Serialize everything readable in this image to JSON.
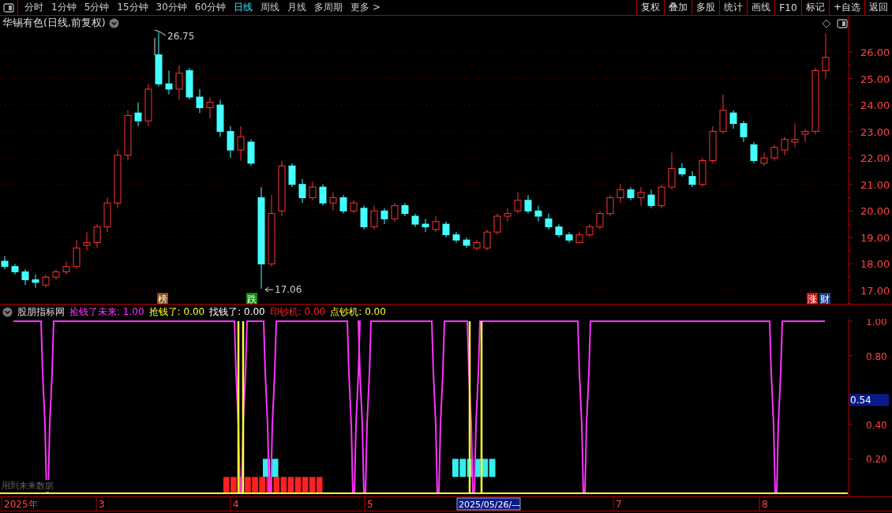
{
  "toolbar": {
    "periods": [
      {
        "label": "分时",
        "selected": false
      },
      {
        "label": "1分钟",
        "selected": false
      },
      {
        "label": "5分钟",
        "selected": false
      },
      {
        "label": "15分钟",
        "selected": false
      },
      {
        "label": "30分钟",
        "selected": false
      },
      {
        "label": "60分钟",
        "selected": false
      },
      {
        "label": "日线",
        "selected": true
      },
      {
        "label": "周线",
        "selected": false
      },
      {
        "label": "月线",
        "selected": false
      },
      {
        "label": "多周期",
        "selected": false
      }
    ],
    "more": "更多 >",
    "buttons": [
      "复权",
      "叠加",
      "多股",
      "统计",
      "画线",
      "F10",
      "标记",
      "+自选",
      "返回"
    ]
  },
  "chart": {
    "title": "华锡有色(日线,前复权)",
    "high_label": "26.75",
    "low_label": "17.06",
    "chart_data": {
      "type": "candlestick",
      "ylim": [
        16.49,
        27.37
      ],
      "grid": true,
      "yticks": [
        {
          "value": 26,
          "label": "26.00"
        },
        {
          "value": 25,
          "label": "25.00"
        },
        {
          "value": 24,
          "label": "24.00"
        },
        {
          "value": 23,
          "label": "23.00"
        },
        {
          "value": 22,
          "label": "22.00"
        },
        {
          "value": 21,
          "label": "21.00"
        },
        {
          "value": 20,
          "label": "20.00"
        },
        {
          "value": 19,
          "label": "19.00"
        },
        {
          "value": 18,
          "label": "18.00"
        },
        {
          "value": 17,
          "label": "17.00"
        }
      ],
      "ohlc": [
        [
          18.1,
          18.3,
          17.8,
          17.9
        ],
        [
          17.9,
          18.0,
          17.6,
          17.7
        ],
        [
          17.7,
          17.8,
          17.2,
          17.4
        ],
        [
          17.4,
          17.6,
          17.1,
          17.3
        ],
        [
          17.2,
          17.6,
          17.1,
          17.5
        ],
        [
          17.5,
          17.8,
          17.4,
          17.7
        ],
        [
          17.7,
          18.1,
          17.6,
          17.9
        ],
        [
          17.9,
          18.9,
          17.8,
          18.6
        ],
        [
          18.7,
          19.2,
          18.5,
          18.8
        ],
        [
          18.8,
          19.5,
          18.6,
          19.4
        ],
        [
          19.4,
          20.5,
          19.2,
          20.3
        ],
        [
          20.3,
          22.3,
          20.1,
          22.1
        ],
        [
          22.1,
          23.8,
          21.9,
          23.6
        ],
        [
          23.7,
          24.1,
          23.2,
          23.4
        ],
        [
          23.4,
          24.8,
          23.2,
          24.6
        ],
        [
          25.9,
          26.75,
          24.7,
          24.8
        ],
        [
          24.8,
          25.3,
          24.4,
          24.6
        ],
        [
          24.6,
          25.5,
          24.2,
          25.2
        ],
        [
          25.3,
          25.4,
          24.2,
          24.3
        ],
        [
          24.3,
          24.6,
          23.7,
          23.9
        ],
        [
          23.9,
          24.3,
          23.5,
          24.1
        ],
        [
          24.0,
          24.2,
          22.8,
          23.0
        ],
        [
          23.0,
          23.2,
          22.0,
          22.3
        ],
        [
          22.3,
          23.2,
          21.9,
          22.8
        ],
        [
          22.6,
          22.7,
          21.7,
          21.8
        ],
        [
          20.5,
          20.9,
          17.06,
          18.0
        ],
        [
          18.0,
          20.6,
          17.9,
          19.9
        ],
        [
          20.0,
          21.9,
          19.8,
          21.7
        ],
        [
          21.7,
          21.8,
          20.9,
          21.0
        ],
        [
          21.0,
          21.2,
          20.3,
          20.5
        ],
        [
          20.5,
          21.1,
          20.4,
          20.9
        ],
        [
          20.9,
          21.0,
          20.2,
          20.3
        ],
        [
          20.3,
          20.7,
          20.0,
          20.5
        ],
        [
          20.5,
          20.6,
          19.9,
          20.0
        ],
        [
          20.0,
          20.4,
          19.9,
          20.3
        ],
        [
          20.1,
          20.2,
          19.3,
          19.4
        ],
        [
          19.4,
          20.2,
          19.3,
          20.0
        ],
        [
          20.0,
          20.1,
          19.5,
          19.7
        ],
        [
          19.7,
          20.3,
          19.6,
          20.2
        ],
        [
          20.2,
          20.3,
          19.8,
          19.9
        ],
        [
          19.8,
          19.9,
          19.4,
          19.5
        ],
        [
          19.5,
          19.7,
          19.2,
          19.4
        ],
        [
          19.3,
          19.8,
          19.2,
          19.6
        ],
        [
          19.5,
          19.6,
          19.0,
          19.1
        ],
        [
          19.1,
          19.2,
          18.8,
          18.9
        ],
        [
          18.9,
          19.0,
          18.6,
          18.7
        ],
        [
          18.6,
          18.9,
          18.5,
          18.8
        ],
        [
          18.6,
          19.3,
          18.5,
          19.2
        ],
        [
          19.2,
          19.9,
          19.1,
          19.8
        ],
        [
          19.8,
          20.1,
          19.6,
          19.9
        ],
        [
          20.0,
          20.7,
          19.9,
          20.4
        ],
        [
          20.4,
          20.6,
          19.9,
          20.0
        ],
        [
          20.0,
          20.2,
          19.6,
          19.8
        ],
        [
          19.7,
          19.9,
          19.3,
          19.4
        ],
        [
          19.4,
          19.5,
          19.0,
          19.1
        ],
        [
          19.1,
          19.2,
          18.8,
          18.9
        ],
        [
          18.8,
          19.2,
          18.8,
          19.1
        ],
        [
          19.1,
          19.5,
          19.0,
          19.4
        ],
        [
          19.4,
          20.0,
          19.3,
          19.9
        ],
        [
          19.9,
          20.6,
          19.8,
          20.5
        ],
        [
          20.5,
          21.0,
          20.3,
          20.8
        ],
        [
          20.8,
          20.9,
          20.4,
          20.5
        ],
        [
          20.5,
          20.9,
          20.2,
          20.7
        ],
        [
          20.6,
          20.8,
          20.1,
          20.2
        ],
        [
          20.2,
          21.0,
          20.1,
          20.9
        ],
        [
          20.9,
          22.2,
          20.8,
          21.6
        ],
        [
          21.6,
          21.8,
          21.3,
          21.4
        ],
        [
          21.3,
          21.5,
          20.9,
          21.0
        ],
        [
          21.0,
          22.0,
          20.9,
          21.9
        ],
        [
          21.9,
          23.2,
          21.8,
          23.0
        ],
        [
          23.0,
          24.4,
          22.9,
          23.8
        ],
        [
          23.7,
          23.8,
          23.1,
          23.3
        ],
        [
          23.3,
          23.4,
          22.6,
          22.8
        ],
        [
          22.5,
          22.6,
          21.8,
          21.9
        ],
        [
          21.8,
          22.2,
          21.7,
          22.0
        ],
        [
          22.0,
          22.5,
          21.9,
          22.4
        ],
        [
          22.3,
          22.8,
          22.1,
          22.7
        ],
        [
          22.6,
          23.3,
          22.4,
          22.7
        ],
        [
          22.9,
          23.1,
          22.6,
          23.0
        ],
        [
          23.0,
          25.4,
          22.9,
          25.3
        ],
        [
          25.3,
          26.7,
          25.0,
          25.8
        ]
      ]
    },
    "markers": [
      {
        "label": "榜",
        "color": "#8a4a10"
      },
      {
        "label": "跌",
        "color": "#118a11"
      },
      {
        "label": "涨",
        "color": "#cc1111"
      },
      {
        "label": "财",
        "color": "#1a3f8a"
      }
    ]
  },
  "indicator": {
    "name": "股朋指标网",
    "values": [
      {
        "text": "捡钱了未来: 1.00",
        "color": "#ff33ff"
      },
      {
        "text": "抢钱了: 0.00",
        "color": "#ffff33"
      },
      {
        "text": "找钱了: 0.00",
        "color": "#ffffff"
      },
      {
        "text": "印钞机: 0.00",
        "color": "#ff2222"
      },
      {
        "text": "点钞机: 0.00",
        "color": "#ffff33"
      }
    ],
    "axis": [
      "1.00",
      "0.80",
      "0.40",
      "0.20"
    ],
    "current": "0.54",
    "note": "用到未来数据"
  },
  "date_axis": {
    "labels": [
      "2025年",
      "3",
      "4",
      "5",
      "7",
      "8"
    ],
    "cursor": "2025/05/26/—"
  }
}
